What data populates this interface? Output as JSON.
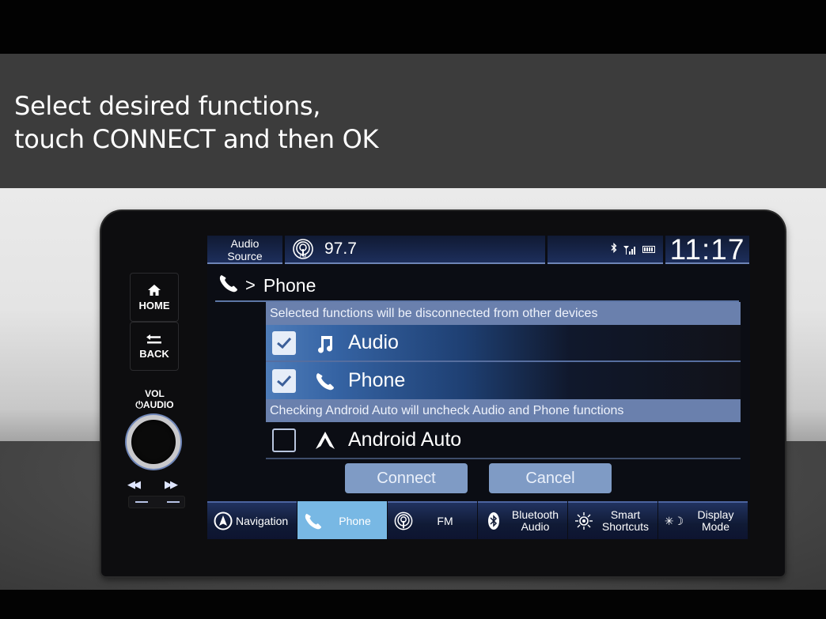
{
  "caption": {
    "line1": "Select desired functions,",
    "line2": "touch CONNECT and then OK"
  },
  "hardware": {
    "home_label": "HOME",
    "back_label": "BACK",
    "vol_label": "VOL",
    "audio_label": "AUDIO",
    "home_icon": "home-icon",
    "back_icon": "back-arrow-icon",
    "power_icon": "power-icon",
    "prev_icon": "skip-previous-icon",
    "next_icon": "skip-next-icon"
  },
  "status_bar": {
    "source_line1": "Audio",
    "source_line2": "Source",
    "radio_band_icon": "fm-radio-icon",
    "frequency": "97.7",
    "bluetooth_icon": "bluetooth-icon",
    "signal_icon": "signal-icon",
    "battery_icon": "battery-icon",
    "clock": "11:17"
  },
  "breadcrumb": {
    "icon": "phone-icon",
    "separator": ">",
    "title": "Phone"
  },
  "list": {
    "notice_top": "Selected functions will be disconnected from other devices",
    "items": [
      {
        "label": "Audio",
        "icon": "music-note-icon",
        "checked": true
      },
      {
        "label": "Phone",
        "icon": "phone-icon",
        "checked": true
      }
    ],
    "notice_android": "Checking Android Auto will uncheck Audio and Phone functions",
    "android_item": {
      "label": "Android Auto",
      "icon": "android-auto-icon",
      "checked": false
    }
  },
  "actions": {
    "connect_label": "Connect",
    "cancel_label": "Cancel"
  },
  "dock": {
    "items": [
      {
        "label": "Navigation",
        "icon": "navigation-icon",
        "active": false
      },
      {
        "label": "Phone",
        "icon": "phone-icon",
        "active": true
      },
      {
        "label": "FM",
        "icon": "fm-radio-icon",
        "active": false
      },
      {
        "label_line1": "Bluetooth",
        "label_line2": "Audio",
        "icon": "bluetooth-icon",
        "active": false
      },
      {
        "label_line1": "Smart",
        "label_line2": "Shortcuts",
        "icon": "smart-shortcuts-icon",
        "active": false
      },
      {
        "label_line1": "Display",
        "label_line2": "Mode",
        "icon": "display-mode-icon",
        "active": false
      }
    ]
  },
  "colors": {
    "accent_active": "#78b8e4",
    "notice_band": "#6a80ad",
    "button": "#7f9bc5"
  }
}
